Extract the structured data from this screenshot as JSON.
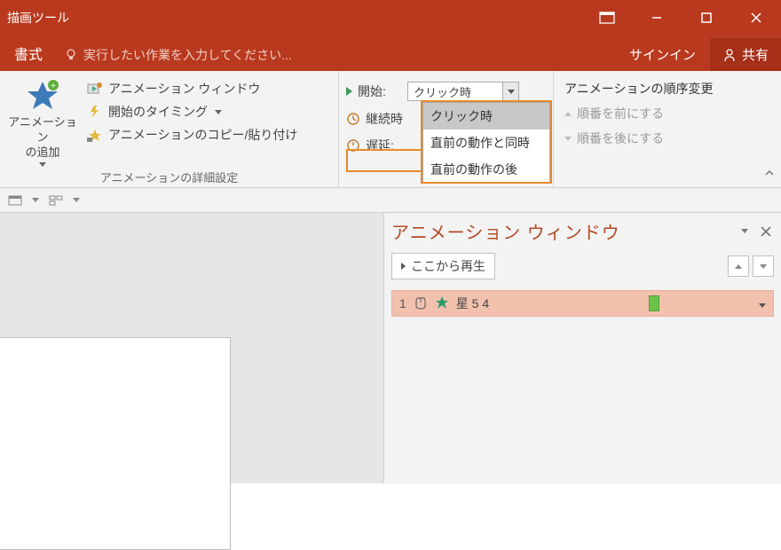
{
  "titlebar": {
    "tool_tab": "描画ツール"
  },
  "tabs": {
    "format": "書式"
  },
  "tellme": {
    "placeholder": "実行したい作業を入力してください..."
  },
  "account": {
    "signin": "サインイン",
    "share": "共有"
  },
  "ribbon": {
    "advanced": {
      "add_animation": "アニメーション\nの追加",
      "animation_pane": "アニメーション ウィンドウ",
      "trigger": "開始のタイミング",
      "animation_painter": "アニメーションのコピー/貼り付け",
      "group_label": "アニメーションの詳細設定"
    },
    "timing": {
      "start_label": "開始:",
      "start_value": "クリック時",
      "duration_label": "継続時",
      "delay_label": "遅延:",
      "options": [
        "クリック時",
        "直前の動作と同時",
        "直前の動作の後"
      ]
    },
    "reorder": {
      "title": "アニメーションの順序変更",
      "move_earlier": "順番を前にする",
      "move_later": "順番を後にする"
    }
  },
  "anim_pane": {
    "title": "アニメーション ウィンドウ",
    "play_from": "ここから再生",
    "items": [
      {
        "index": "1",
        "name": "星 5 4"
      }
    ]
  }
}
